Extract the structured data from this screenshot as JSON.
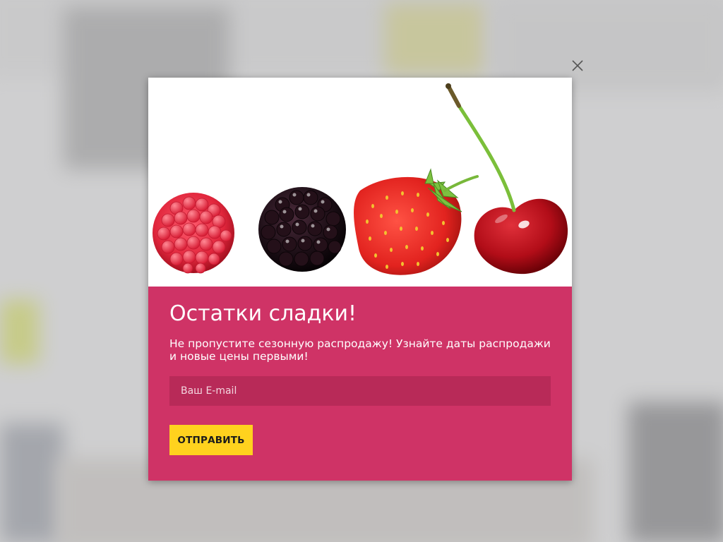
{
  "background": {
    "overlay_color": "#b9b9bc"
  },
  "popup": {
    "close_icon": "close-icon",
    "hero_image": "berries-photo",
    "title": "Остатки сладки!",
    "description": "Не пропустите сезонную распродажу! Узнайте даты распродажи и новые цены первыми!",
    "email_placeholder": "Ваш E-mail",
    "email_value": "",
    "submit_label": "ОТПРАВИТЬ"
  },
  "colors": {
    "modal_background": "#cf3366",
    "input_background": "#b82a58",
    "button_background": "#ffd21e",
    "text": "#ffffff"
  }
}
